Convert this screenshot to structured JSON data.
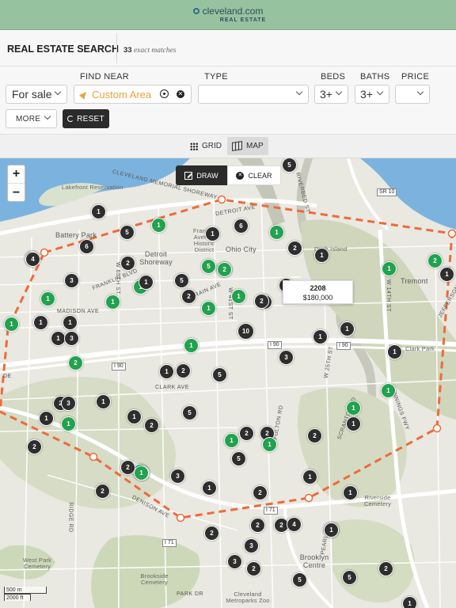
{
  "header": {
    "brand": "cleveland.com",
    "sub": "REAL ESTATE",
    "brand_color": "#97c2a0"
  },
  "titlebar": {
    "title": "REAL ESTATE SEARCH",
    "count": "33",
    "count_suffix": "exact matches"
  },
  "filters": {
    "listing_type": "For sale",
    "find_near_label": "FIND NEAR",
    "find_near_placeholder": "Custom Area",
    "type_label": "TYPE",
    "type_value": "",
    "beds_label": "BEDS",
    "beds_value": "3+",
    "baths_label": "BATHS",
    "baths_value": "3+",
    "price_label": "PRICE",
    "price_value": "",
    "more_label": "MORE",
    "reset_label": "RESET"
  },
  "view_toggle": {
    "grid_label": "GRID",
    "map_label": "MAP",
    "active": "MAP"
  },
  "map": {
    "zoom_in": "+",
    "zoom_out": "−",
    "draw_label": "DRAW",
    "clear_label": "CLEAR",
    "popup": {
      "id": "2208",
      "price": "$180,000"
    },
    "scale": {
      "metric": "500 m",
      "imperial": "2000 ft"
    },
    "area_labels": [
      "Lakefront Reservation",
      "Battery Park",
      "Franklin Avenue Historic District",
      "Detroit Shoreway",
      "Ohio City",
      "Duck Island",
      "Tremont",
      "Clark Park",
      "Riverside Cemetery",
      "West Park Cemetery",
      "Brookside Cemetery",
      "Cleveland Metroparks Zoo",
      "Brooklyn Centre"
    ],
    "road_labels": [
      "CLEVELAND MEMORIAL SHOREWAY",
      "DETROIT AVE",
      "FRANKLIN BLVD",
      "MADISON AVE",
      "LORAIN AVE",
      "CLARK AVE",
      "DENISON AVE",
      "W 65TH ST",
      "W 25TH ST",
      "W 41ST ST",
      "RIDGE RD",
      "FULTON RD",
      "SCRANTON RD",
      "PEARL RD",
      "JENNINGS FWY",
      "PARK DR",
      "RIVERBED ST",
      "JEFFERSON AVE",
      "W 14TH ST",
      "DE"
    ],
    "shields": [
      "SR 10",
      "I 90",
      "I 90",
      "I 90",
      "I 71",
      "I 71"
    ],
    "markers": [
      {
        "label": "5",
        "color": "dark"
      },
      {
        "label": "6",
        "color": "dark"
      },
      {
        "label": "1",
        "color": "dark"
      },
      {
        "label": "5",
        "color": "dark"
      },
      {
        "label": "1",
        "color": "green"
      },
      {
        "label": "1",
        "color": "dark"
      },
      {
        "label": "6",
        "color": "dark"
      },
      {
        "label": "1",
        "color": "green"
      },
      {
        "label": "7",
        "color": "dark"
      },
      {
        "label": "4",
        "color": "dark"
      },
      {
        "label": "2",
        "color": "green"
      },
      {
        "label": "2",
        "color": "dark"
      },
      {
        "label": "1",
        "color": "dark"
      },
      {
        "label": "2",
        "color": "green"
      },
      {
        "label": "1",
        "color": "green"
      },
      {
        "label": "2",
        "color": "dark"
      },
      {
        "label": "3",
        "color": "dark"
      },
      {
        "label": "5",
        "color": "dark"
      },
      {
        "label": "5",
        "color": "green"
      },
      {
        "label": "2",
        "color": "green"
      },
      {
        "label": "1",
        "color": "green"
      },
      {
        "label": "1",
        "color": "dark"
      },
      {
        "label": "1",
        "color": "green"
      },
      {
        "label": "1",
        "color": "green"
      },
      {
        "label": "1",
        "color": "dark"
      },
      {
        "label": "2",
        "color": "dark"
      },
      {
        "label": "1",
        "color": "green"
      },
      {
        "label": "1",
        "color": "green"
      },
      {
        "label": "2",
        "color": "dark"
      },
      {
        "label": "2",
        "color": "dark"
      },
      {
        "label": "1",
        "color": "dark"
      },
      {
        "label": "1",
        "color": "green"
      },
      {
        "label": "1",
        "color": "dark"
      },
      {
        "label": "1",
        "color": "dark"
      },
      {
        "label": "1",
        "color": "dark"
      },
      {
        "label": "3",
        "color": "dark"
      },
      {
        "label": "10",
        "color": "dark"
      },
      {
        "label": "1",
        "color": "dark"
      },
      {
        "label": "1",
        "color": "dark"
      },
      {
        "label": "1",
        "color": "dark"
      },
      {
        "label": "3",
        "color": "dark"
      },
      {
        "label": "2",
        "color": "green"
      },
      {
        "label": "1",
        "color": "green"
      },
      {
        "label": "1",
        "color": "dark"
      },
      {
        "label": "2",
        "color": "dark"
      },
      {
        "label": "5",
        "color": "dark"
      },
      {
        "label": "1",
        "color": "green"
      },
      {
        "label": "1",
        "color": "green"
      },
      {
        "label": "2",
        "color": "dark"
      },
      {
        "label": "3",
        "color": "dark"
      },
      {
        "label": "1",
        "color": "dark"
      },
      {
        "label": "2",
        "color": "dark"
      },
      {
        "label": "1",
        "color": "dark"
      },
      {
        "label": "5",
        "color": "dark"
      },
      {
        "label": "1",
        "color": "dark"
      },
      {
        "label": "2",
        "color": "dark"
      },
      {
        "label": "1",
        "color": "green"
      },
      {
        "label": "1",
        "color": "dark"
      },
      {
        "label": "1",
        "color": "green"
      },
      {
        "label": "2",
        "color": "dark"
      },
      {
        "label": "2",
        "color": "dark"
      },
      {
        "label": "1",
        "color": "green"
      },
      {
        "label": "1",
        "color": "green"
      },
      {
        "label": "1",
        "color": "green"
      },
      {
        "label": "5",
        "color": "dark"
      },
      {
        "label": "2",
        "color": "dark"
      },
      {
        "label": "2",
        "color": "dark"
      },
      {
        "label": "1",
        "color": "dark"
      },
      {
        "label": "3",
        "color": "dark"
      },
      {
        "label": "1",
        "color": "green"
      },
      {
        "label": "1",
        "color": "dark"
      },
      {
        "label": "2",
        "color": "dark"
      },
      {
        "label": "2",
        "color": "dark"
      },
      {
        "label": "1",
        "color": "dark"
      },
      {
        "label": "2",
        "color": "dark"
      },
      {
        "label": "4",
        "color": "dark"
      },
      {
        "label": "4",
        "color": "dark"
      },
      {
        "label": "2",
        "color": "dark"
      },
      {
        "label": "1",
        "color": "dark"
      },
      {
        "label": "2",
        "color": "dark"
      },
      {
        "label": "3",
        "color": "dark"
      },
      {
        "label": "3",
        "color": "dark"
      },
      {
        "label": "2",
        "color": "dark"
      },
      {
        "label": "5",
        "color": "dark"
      },
      {
        "label": "2",
        "color": "dark"
      },
      {
        "label": "5",
        "color": "dark"
      },
      {
        "label": "1",
        "color": "dark"
      }
    ]
  }
}
